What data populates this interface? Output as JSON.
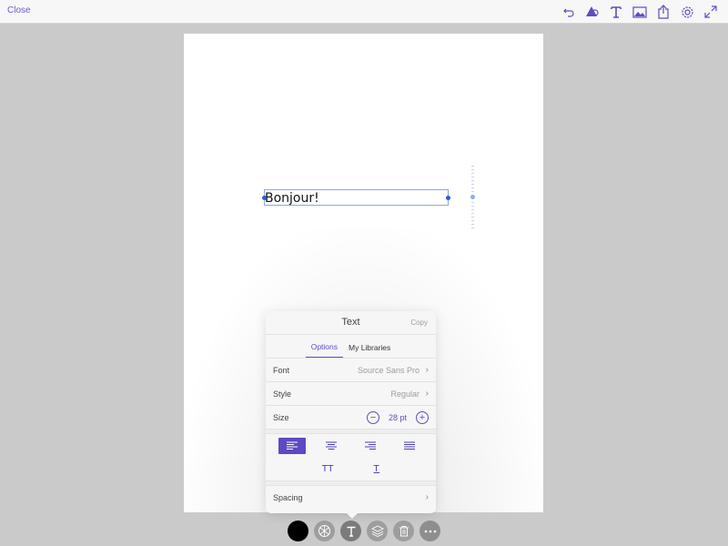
{
  "topbar": {
    "close_label": "Close",
    "icons": [
      "undo-icon",
      "shape-icon",
      "text-icon",
      "image-icon",
      "share-icon",
      "settings-icon",
      "fullscreen-icon"
    ]
  },
  "canvas": {
    "text_content": "Bonjour!"
  },
  "panel": {
    "title": "Text",
    "copy_label": "Copy",
    "tabs": [
      {
        "label": "Options",
        "active": true
      },
      {
        "label": "My Libraries",
        "active": false
      }
    ],
    "font": {
      "label": "Font",
      "value": "Source Sans Pro"
    },
    "style": {
      "label": "Style",
      "value": "Regular"
    },
    "size": {
      "label": "Size",
      "value": "28 pt"
    },
    "alignments": [
      "align-left",
      "align-center",
      "align-right",
      "align-justify"
    ],
    "active_alignment": "align-left",
    "case_all_caps": "TT",
    "case_underline": "T",
    "spacing": {
      "label": "Spacing"
    }
  },
  "bottom_tools": [
    "color-swatch",
    "appearance-icon",
    "text-icon",
    "layers-icon",
    "trash-icon",
    "more-icon"
  ],
  "colors": {
    "accent": "#5b4fc2",
    "selected_color": "#000000",
    "canvas_bg": "#cacaca"
  }
}
